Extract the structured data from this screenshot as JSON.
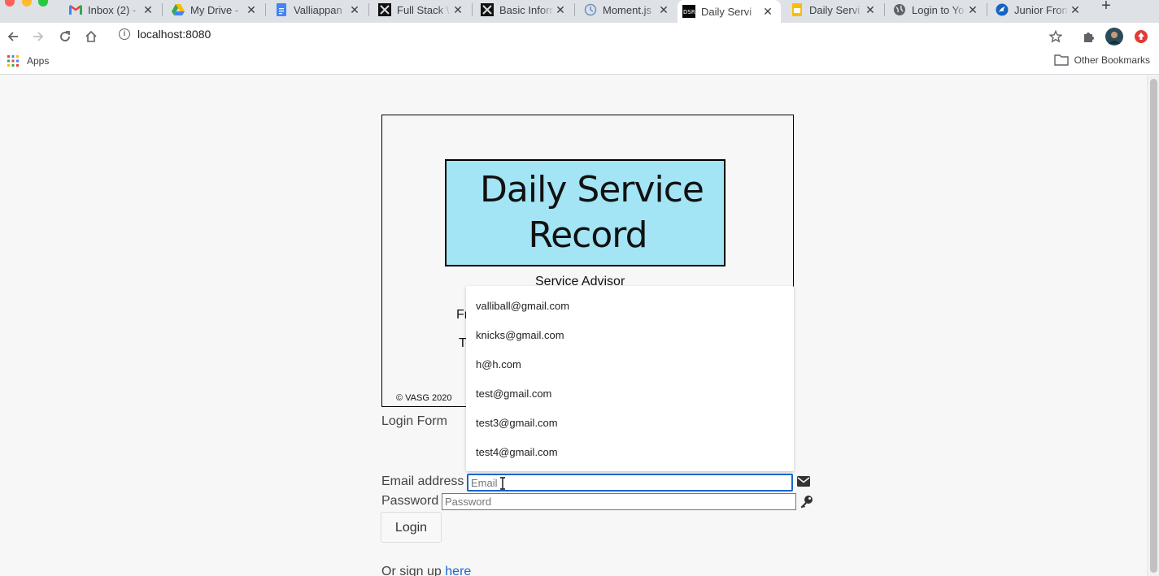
{
  "browser": {
    "tabs": [
      {
        "title": "Inbox (2) - ",
        "icon": "gmail-icon"
      },
      {
        "title": "My Drive - ",
        "icon": "drive-icon"
      },
      {
        "title": "Valliappan",
        "icon": "docs-icon"
      },
      {
        "title": "Full Stack \\",
        "icon": "site-icon"
      },
      {
        "title": "Basic Inforr",
        "icon": "site-icon"
      },
      {
        "title": "Moment.js",
        "icon": "clock-icon"
      },
      {
        "title": "Daily Servi",
        "icon": "dsr-icon"
      },
      {
        "title": "Daily Servi",
        "icon": "slides-icon"
      },
      {
        "title": "Login to Yo",
        "icon": "globe-icon"
      },
      {
        "title": "Junior Fron",
        "icon": "bird-icon"
      }
    ],
    "url": "localhost:8080",
    "bookmarks": {
      "apps_label": "Apps",
      "other_label": "Other Bookmarks"
    },
    "colors": {
      "tabstrip": "#dee1e6",
      "link": "#1a66c9",
      "logo_bg": "#a3e4f5"
    }
  },
  "page": {
    "logo": {
      "line1": "Daily Service",
      "line2": "Record"
    },
    "card_text": {
      "service_advisor": "Service Advisor",
      "fr": "Fr",
      "t": "T",
      "copyright": "© VASG 2020"
    },
    "login_form_title": "Login Form",
    "autocomplete": [
      "valliball@gmail.com",
      "knicks@gmail.com",
      "h@h.com",
      "test@gmail.com",
      "test3@gmail.com",
      "test4@gmail.com"
    ],
    "email_label": "Email address",
    "email_placeholder": "Email",
    "password_label": "Password",
    "password_placeholder": "Password",
    "login_button": "Login",
    "signup_prefix": "Or sign up ",
    "signup_link": "here"
  }
}
